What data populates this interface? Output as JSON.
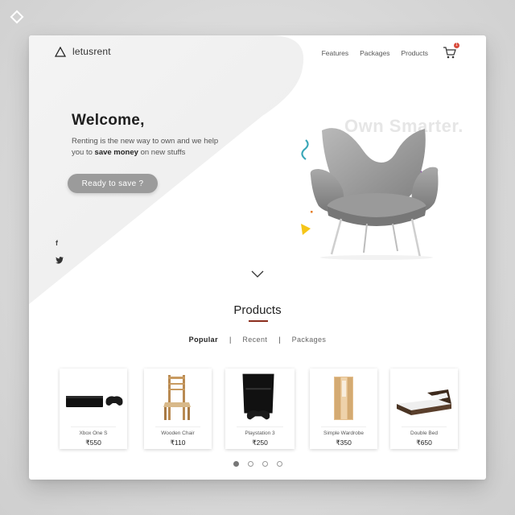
{
  "header": {
    "brand": "letusrent",
    "nav": [
      "Features",
      "Packages",
      "Products"
    ],
    "cart_count": "1"
  },
  "hero": {
    "title": "Welcome,",
    "tagline_pre": "Renting is the new way to own and we help you to ",
    "tagline_bold": "save money",
    "tagline_post": " on new stuffs",
    "cta": "Ready to save ?",
    "watermark": "Own Smarter."
  },
  "social": {
    "facebook": "f",
    "twitter": "t"
  },
  "products": {
    "title": "Products",
    "tabs": [
      "Popular",
      "Recent",
      "Packages"
    ],
    "separator": "|",
    "active_tab": "Popular",
    "items": [
      {
        "name": "Xbox One S",
        "price": "₹550",
        "icon": "xbox-console-icon"
      },
      {
        "name": "Wooden Chair",
        "price": "₹110",
        "icon": "wooden-chair-icon"
      },
      {
        "name": "Playstation 3",
        "price": "₹250",
        "icon": "playstation-icon"
      },
      {
        "name": "Simple Wardrobe",
        "price": "₹350",
        "icon": "wardrobe-icon"
      },
      {
        "name": "Double Bed",
        "price": "₹650",
        "icon": "double-bed-icon"
      }
    ]
  },
  "pagination": {
    "pages": 4,
    "active": 1
  },
  "colors": {
    "accent": "#8b2e1e",
    "cta_bg": "#9b9b9b",
    "badge": "#d84a3a"
  }
}
